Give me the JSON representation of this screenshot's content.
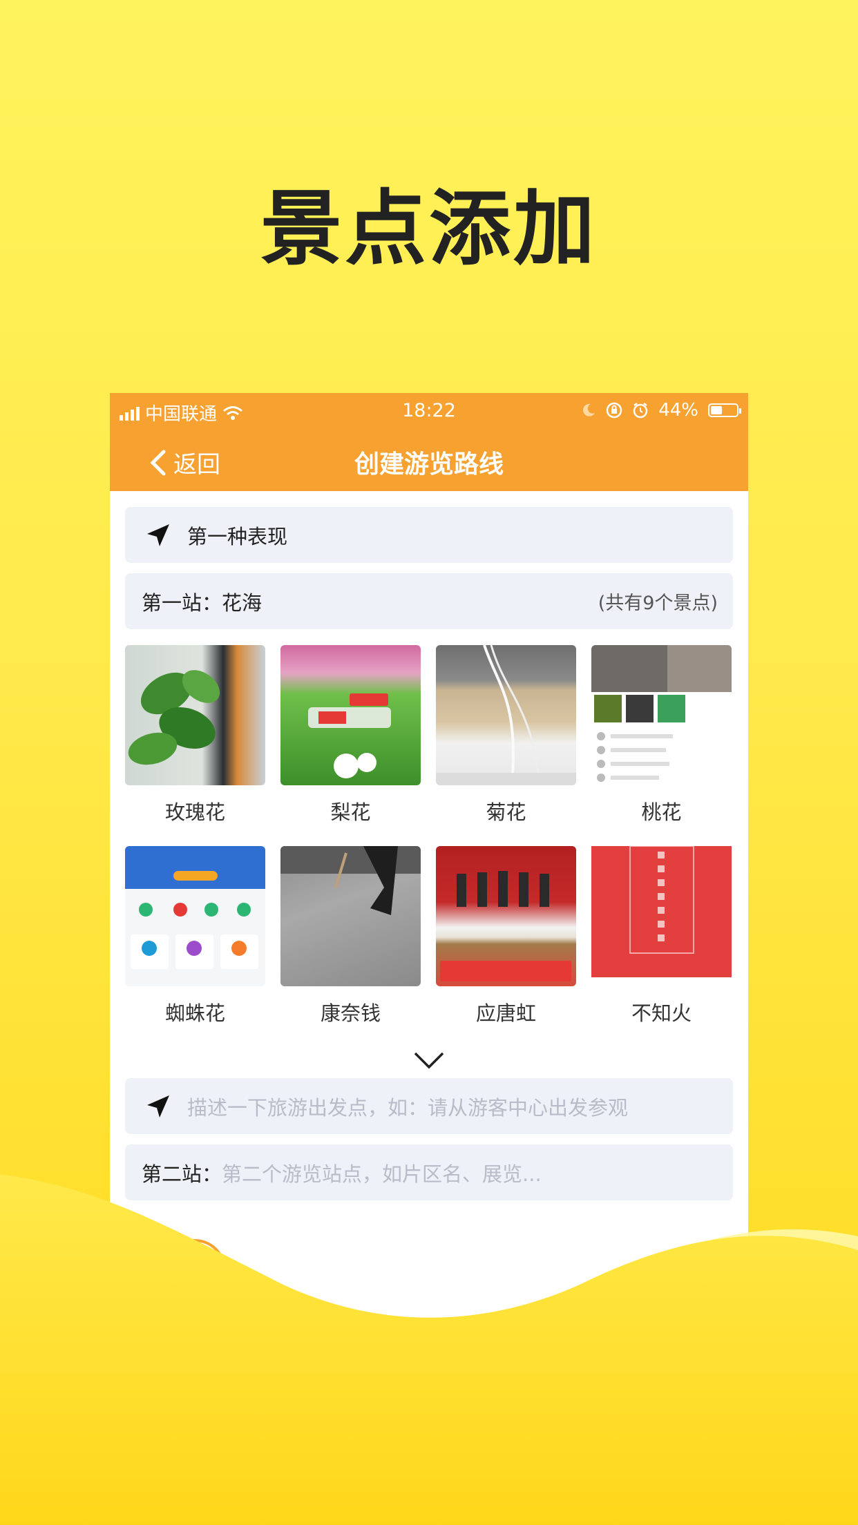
{
  "hero": {
    "title": "景点添加"
  },
  "status_bar": {
    "carrier": "中国联通",
    "time": "18:22",
    "battery": "44%",
    "battery_level": 0.44
  },
  "nav": {
    "back_label": "返回",
    "title": "创建游览路线"
  },
  "start_point": {
    "text": "第一种表现"
  },
  "station1": {
    "prefix": "第一站：",
    "name": "花海",
    "count": "(共有9个景点)"
  },
  "spots": [
    {
      "label": "玫瑰花",
      "thumb": "plant-photo"
    },
    {
      "label": "梨花",
      "thumb": "flower-ad"
    },
    {
      "label": "菊花",
      "thumb": "desk-photo"
    },
    {
      "label": "桃花",
      "thumb": "app-screenshot"
    },
    {
      "label": "蜘蛛花",
      "thumb": "app-screenshot"
    },
    {
      "label": "康奈钱",
      "thumb": "street-photo"
    },
    {
      "label": "应唐虹",
      "thumb": "news-photo"
    },
    {
      "label": "不知火",
      "thumb": "red-card"
    }
  ],
  "start_input": {
    "placeholder": "描述一下旅游出发点，如：请从游客中心出发参观"
  },
  "station2": {
    "prefix": "第二站：",
    "placeholder": "第二个游览站点，如片区名、展览..."
  },
  "colors": {
    "accent": "#f7a131",
    "background": "#ffe94a",
    "row_bg": "#eef1f7"
  }
}
